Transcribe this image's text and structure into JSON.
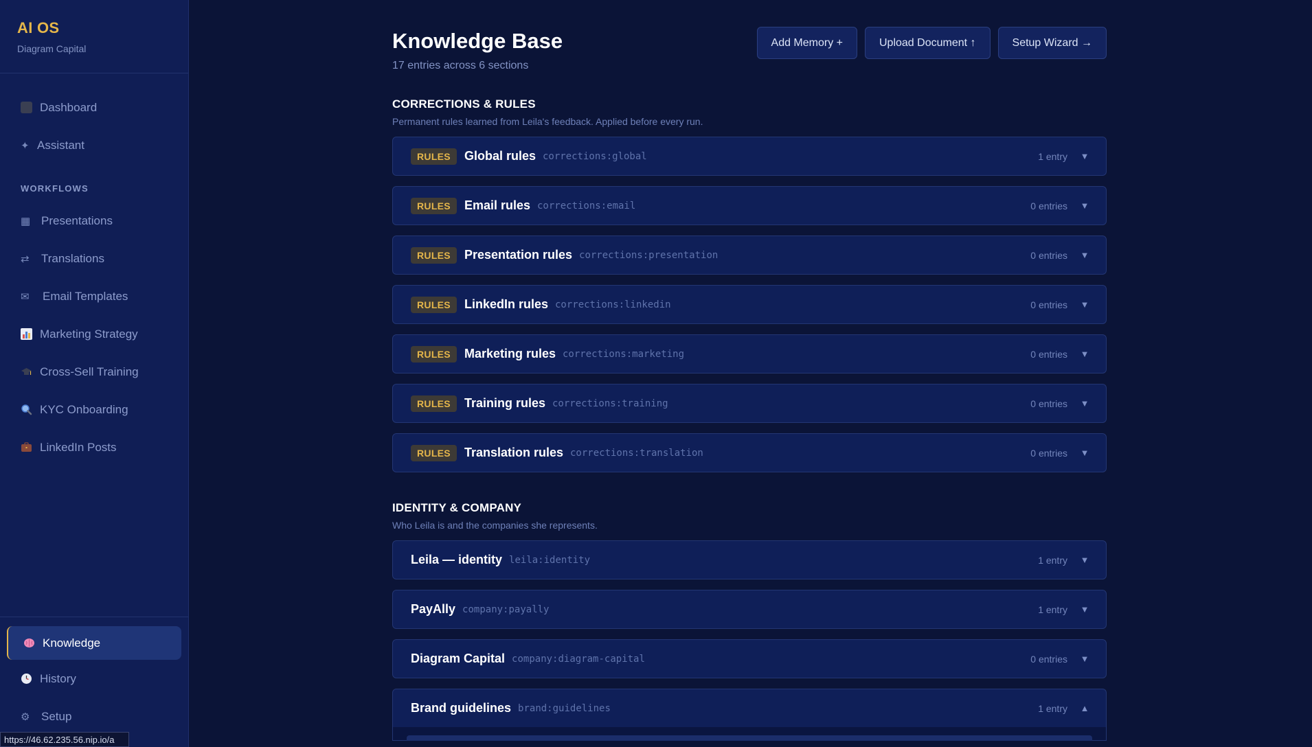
{
  "brand": {
    "title": "AI OS",
    "subtitle": "Diagram Capital"
  },
  "nav": {
    "top_items": [
      {
        "label": "Dashboard",
        "icon": "dashboard-square-icon"
      },
      {
        "label": "Assistant",
        "icon": "sparkle-icon"
      }
    ],
    "section_label": "WORKFLOWS",
    "workflow_items": [
      {
        "label": "Presentations",
        "icon": "grid-icon"
      },
      {
        "label": "Translations",
        "icon": "swap-arrows-icon"
      },
      {
        "label": "Email Templates",
        "icon": "envelope-icon"
      },
      {
        "label": "Marketing Strategy",
        "icon": "bar-chart-icon"
      },
      {
        "label": "Cross-Sell Training",
        "icon": "graduation-cap-icon"
      },
      {
        "label": "KYC Onboarding",
        "icon": "magnifier-icon"
      },
      {
        "label": "LinkedIn Posts",
        "icon": "briefcase-icon"
      }
    ],
    "bottom_items": [
      {
        "label": "Knowledge",
        "icon": "brain-icon",
        "active": true
      },
      {
        "label": "History",
        "icon": "clock-icon"
      },
      {
        "label": "Setup",
        "icon": "gear-icon"
      }
    ]
  },
  "header": {
    "title": "Knowledge Base",
    "subtitle": "17 entries across 6 sections",
    "buttons": [
      "Add Memory +",
      "Upload Document ↑",
      "Setup Wizard →"
    ]
  },
  "sections": [
    {
      "title": "CORRECTIONS & RULES",
      "description": "Permanent rules learned from Leila's feedback. Applied before every run.",
      "rows": [
        {
          "badge": "RULES",
          "name": "Global rules",
          "key": "corrections:global",
          "count": "1 entry",
          "expanded": false
        },
        {
          "badge": "RULES",
          "name": "Email rules",
          "key": "corrections:email",
          "count": "0 entries",
          "expanded": false
        },
        {
          "badge": "RULES",
          "name": "Presentation rules",
          "key": "corrections:presentation",
          "count": "0 entries",
          "expanded": false
        },
        {
          "badge": "RULES",
          "name": "LinkedIn rules",
          "key": "corrections:linkedin",
          "count": "0 entries",
          "expanded": false
        },
        {
          "badge": "RULES",
          "name": "Marketing rules",
          "key": "corrections:marketing",
          "count": "0 entries",
          "expanded": false
        },
        {
          "badge": "RULES",
          "name": "Training rules",
          "key": "corrections:training",
          "count": "0 entries",
          "expanded": false
        },
        {
          "badge": "RULES",
          "name": "Translation rules",
          "key": "corrections:translation",
          "count": "0 entries",
          "expanded": false
        }
      ]
    },
    {
      "title": "IDENTITY & COMPANY",
      "description": "Who Leila is and the companies she represents.",
      "rows": [
        {
          "badge": "",
          "name": "Leila — identity",
          "key": "leila:identity",
          "count": "1 entry",
          "expanded": false
        },
        {
          "badge": "",
          "name": "PayAlly",
          "key": "company:payally",
          "count": "1 entry",
          "expanded": false
        },
        {
          "badge": "",
          "name": "Diagram Capital",
          "key": "company:diagram-capital",
          "count": "0 entries",
          "expanded": false
        },
        {
          "badge": "",
          "name": "Brand guidelines",
          "key": "brand:guidelines",
          "count": "1 entry",
          "expanded": true
        }
      ]
    }
  ],
  "status_url": "https://46.62.235.56.nip.io/a",
  "colors": {
    "accent": "#e5b64a",
    "background": "#0b1437",
    "sidebar": "#101e55"
  }
}
